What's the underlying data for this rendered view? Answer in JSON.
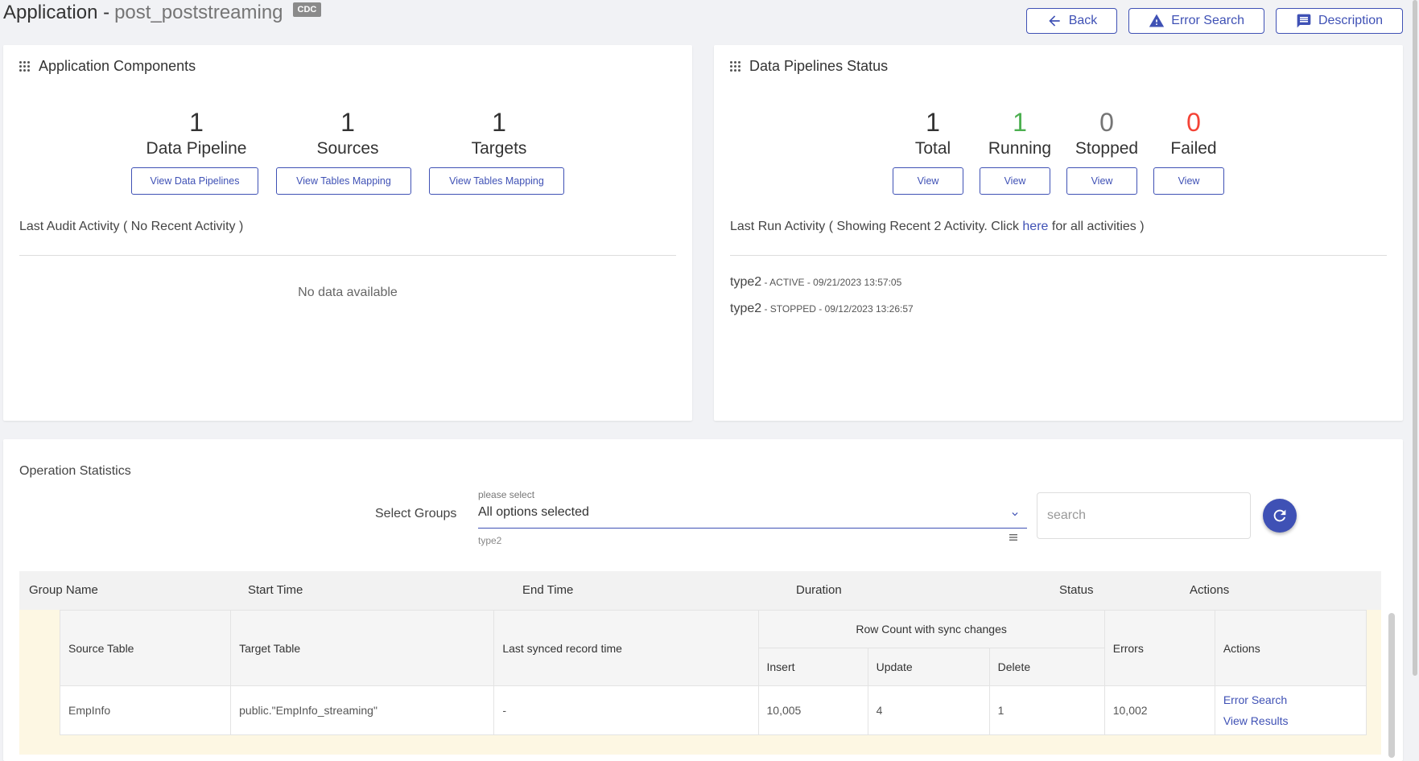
{
  "header": {
    "title_prefix": "Application - ",
    "app_name": "post_poststreaming",
    "badge": "CDC",
    "back_label": "Back",
    "error_search_label": "Error Search",
    "description_label": "Description"
  },
  "components": {
    "title": "Application Components",
    "stats": [
      {
        "value": "1",
        "label": "Data Pipeline",
        "button": "View Data Pipelines"
      },
      {
        "value": "1",
        "label": "Sources",
        "button": "View Tables Mapping"
      },
      {
        "value": "1",
        "label": "Targets",
        "button": "View Tables Mapping"
      }
    ],
    "audit_title": "Last Audit Activity ( No Recent Activity )",
    "no_data": "No data available"
  },
  "pipelines": {
    "title": "Data Pipelines Status",
    "stats": [
      {
        "value": "1",
        "label": "Total",
        "button": "View"
      },
      {
        "value": "1",
        "label": "Running",
        "button": "View"
      },
      {
        "value": "0",
        "label": "Stopped",
        "button": "View"
      },
      {
        "value": "0",
        "label": "Failed",
        "button": "View"
      }
    ],
    "colors": {
      "total": "#333333",
      "running": "#4caf50",
      "stopped": "#757575",
      "failed": "#f44336"
    },
    "activity_prefix": "Last Run Activity ( Showing Recent 2 Activity. Click ",
    "activity_link": "here",
    "activity_suffix": " for all activities )",
    "runs": [
      {
        "name": "type2",
        "detail": " - ACTIVE - 09/21/2023 13:57:05"
      },
      {
        "name": "type2",
        "detail": " - STOPPED - 09/12/2023 13:26:57"
      }
    ]
  },
  "operations": {
    "title": "Operation Statistics",
    "select_label": "Select Groups",
    "select_hint": "please select",
    "select_value": "All options selected",
    "select_sub": "type2",
    "search_placeholder": "search",
    "group_columns": [
      "Group Name",
      "Start Time",
      "End Time",
      "Duration",
      "Status",
      "Actions"
    ],
    "inner_headers": {
      "source": "Source Table",
      "target": "Target Table",
      "last_synced": "Last synced record time",
      "row_count": "Row Count with sync changes",
      "insert": "Insert",
      "update": "Update",
      "delete": "Delete",
      "errors": "Errors",
      "actions": "Actions"
    },
    "rows": [
      {
        "source": "EmpInfo",
        "target": "public.\"EmpInfo_streaming\"",
        "last_synced": "-",
        "insert": "10,005",
        "update": "4",
        "delete": "1",
        "errors": "10,002",
        "action_error": "Error Search",
        "action_results": "View Results"
      }
    ]
  },
  "accent_color": "#3f51b5"
}
